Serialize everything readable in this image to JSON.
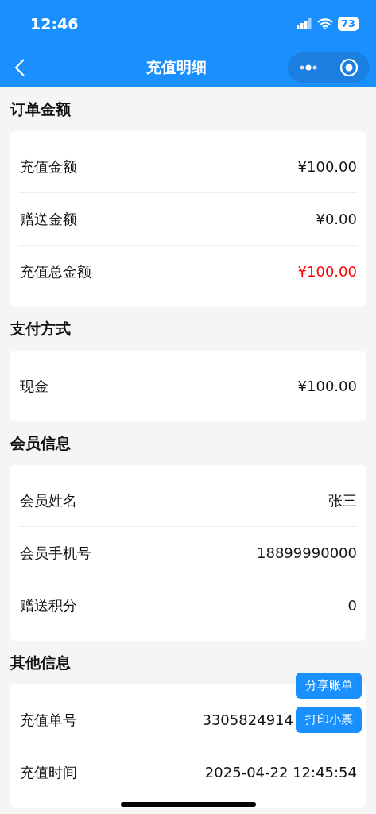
{
  "status_bar": {
    "time": "12:46",
    "battery": "73"
  },
  "nav": {
    "title": "充值明细"
  },
  "sections": [
    {
      "title": "订单金额",
      "rows": [
        {
          "label": "充值金额",
          "value": "¥100.00",
          "highlight": false
        },
        {
          "label": "赠送金额",
          "value": "¥0.00",
          "highlight": false
        },
        {
          "label": "充值总金额",
          "value": "¥100.00",
          "highlight": true
        }
      ]
    },
    {
      "title": "支付方式",
      "rows": [
        {
          "label": "现金",
          "value": "¥100.00",
          "highlight": false
        }
      ]
    },
    {
      "title": "会员信息",
      "rows": [
        {
          "label": "会员姓名",
          "value": "张三",
          "highlight": false
        },
        {
          "label": "会员手机号",
          "value": "18899990000",
          "highlight": false
        },
        {
          "label": "赠送积分",
          "value": "0",
          "highlight": false
        }
      ]
    },
    {
      "title": "其他信息",
      "rows": [
        {
          "label": "充值单号",
          "value": "3305824914",
          "highlight": false,
          "kind": "covered"
        },
        {
          "label": "充值时间",
          "value": "2025-04-22 12:45:54",
          "highlight": false
        }
      ]
    }
  ],
  "float_buttons": [
    "分享账单",
    "打印小票"
  ]
}
